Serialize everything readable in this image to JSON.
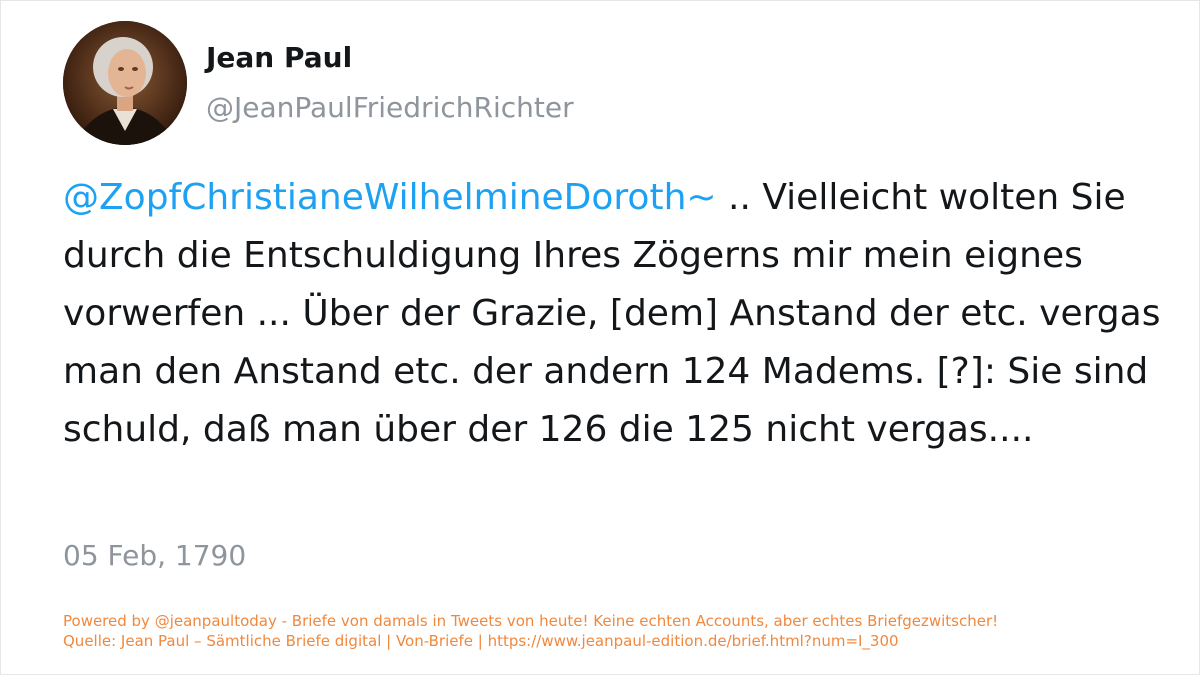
{
  "tweet": {
    "author_name": "Jean Paul",
    "author_handle": "@JeanPaulFriedrichRichter",
    "mention": "@ZopfChristianeWilhelmineDoroth~",
    "text": " .. Vielleicht wolten Sie durch die Entschuldigung Ihres Zögerns mir mein eignes vorwerfen ... Über der Grazie, [dem] Anstand der etc. vergas man den Anstand etc. der andern 124 Madems. [?]: Sie sind schuld, daß man über der 126 die 125 nicht vergas....",
    "date": "05 Feb, 1790",
    "avatar_icon": "portrait-avatar"
  },
  "footer": {
    "line1": "Powered by @jeanpaultoday - Briefe von damals in Tweets von heute! Keine echten Accounts, aber echtes Briefgezwitscher!",
    "line2": "Quelle: Jean Paul – Sämtliche Briefe digital | Von-Briefe | https://www.jeanpaul-edition.de/brief.html?num=I_300"
  },
  "colors": {
    "mention": "#1da1f2",
    "text": "#14171a",
    "muted": "#8e959c",
    "footer": "#f0883e"
  }
}
